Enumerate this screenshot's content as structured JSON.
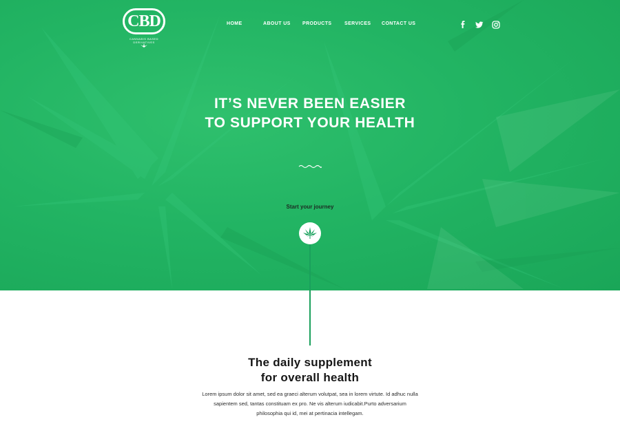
{
  "brand": {
    "logo_text": "CBD",
    "logo_subtext": "CANNABIS BASED DERIVATIVES"
  },
  "nav": {
    "items": [
      "HOME",
      "ABOUT US",
      "PRODUCTS",
      "SERVICES",
      "CONTACT US"
    ]
  },
  "social": {
    "icons": [
      "facebook-icon",
      "twitter-icon",
      "instagram-icon"
    ]
  },
  "hero": {
    "headline_line1": "IT’S NEVER BEEN EASIER",
    "headline_line2": "TO SUPPORT YOUR HEALTH",
    "cta_label": "Start your journey",
    "cta_icon": "cannabis-leaf-icon"
  },
  "section": {
    "title_line1": "The daily supplement",
    "title_line2": "for overall health",
    "body_line1": "Lorem ipsum dolor sit amet, sed ea graeci alterum volutpat, sea in lorem virtute. Id adhuc nulla",
    "body_line2": "sapientem sed, tantas constituam ex pro. Ne vis alterum iudicabit.Purto adversarium",
    "body_line3": "philosophia qui id, mei at pertinacia intellegam."
  },
  "colors": {
    "hero_green": "#22b463",
    "accent_green": "#1aa05c",
    "text_dark": "#161616"
  }
}
